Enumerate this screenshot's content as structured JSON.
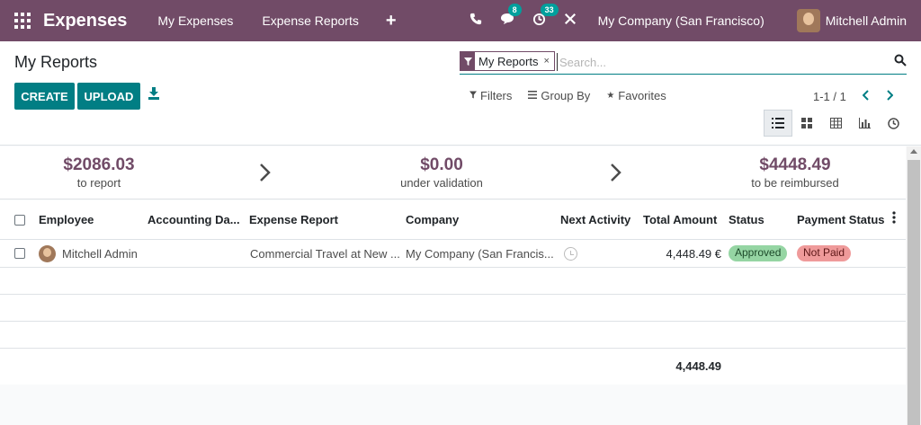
{
  "navbar": {
    "app_title": "Expenses",
    "links": [
      "My Expenses",
      "Expense Reports"
    ],
    "plus": "+",
    "messages_count": "8",
    "activities_count": "33",
    "company": "My Company (San Francisco)",
    "user": "Mitchell Admin"
  },
  "control": {
    "page_title": "My Reports",
    "create_label": "CREATE",
    "upload_label": "UPLOAD",
    "facet_label": "My Reports",
    "facet_remove": "×",
    "search_placeholder": "Search...",
    "filters_label": "Filters",
    "groupby_label": "Group By",
    "favorites_label": "Favorites",
    "pager_text": "1-1 / 1"
  },
  "summary": [
    {
      "amount": "$2086.03",
      "label": "to report"
    },
    {
      "amount": "$0.00",
      "label": "under validation"
    },
    {
      "amount": "$4448.49",
      "label": "to be reimbursed"
    }
  ],
  "table": {
    "columns": [
      "Employee",
      "Accounting Da...",
      "Expense Report",
      "Company",
      "Next Activity",
      "Total Amount",
      "Status",
      "Payment Status"
    ],
    "rows": [
      {
        "employee": "Mitchell Admin",
        "accounting_date": "",
        "expense_report": "Commercial Travel at New ...",
        "company": "My Company (San Francis...",
        "total_amount": "4,448.49 €",
        "status": "Approved",
        "payment_status": "Not Paid"
      }
    ],
    "footer_total": "4,448.49"
  },
  "colors": {
    "brand": "#714b67",
    "accent": "#017e84",
    "approved": "#95d5a3",
    "not_paid": "#ef9a9a"
  }
}
